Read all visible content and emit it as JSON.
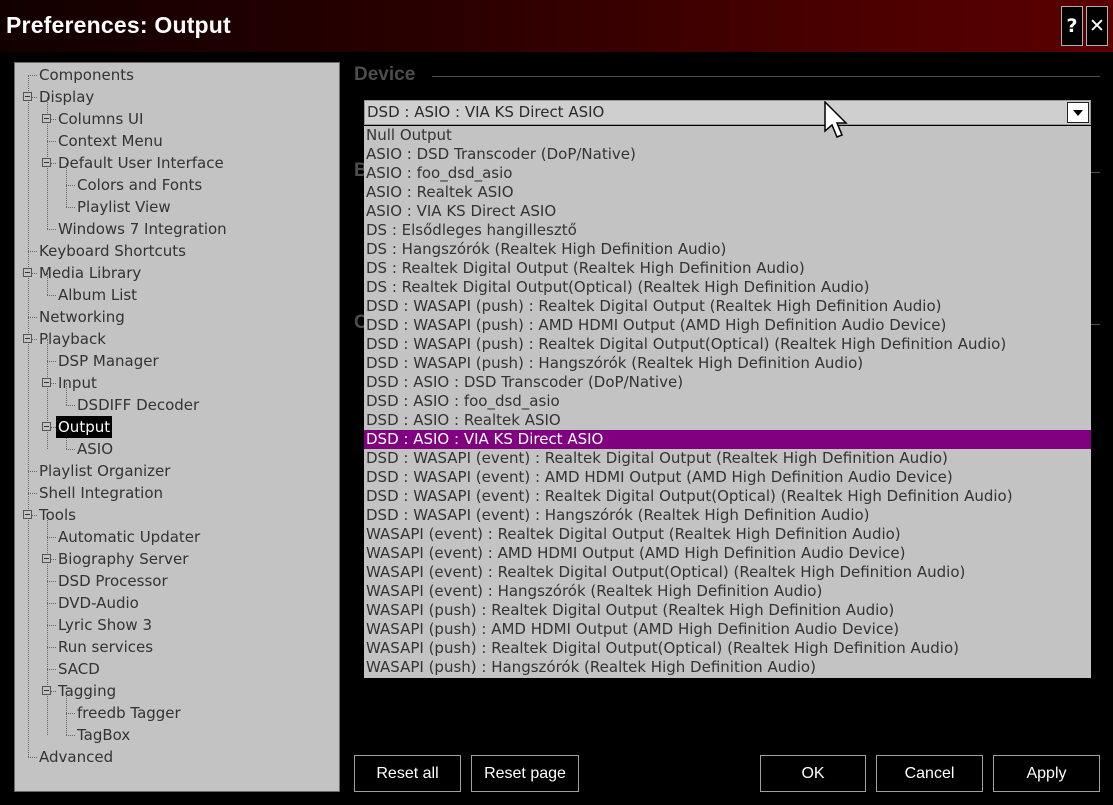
{
  "window": {
    "title": "Preferences: Output",
    "help_label": "?",
    "close_label": "✕"
  },
  "tree": {
    "items": [
      {
        "label": "Components"
      },
      {
        "label": "Display"
      },
      {
        "label": "Columns UI"
      },
      {
        "label": "Context Menu"
      },
      {
        "label": "Default User Interface"
      },
      {
        "label": "Colors and Fonts"
      },
      {
        "label": "Playlist View"
      },
      {
        "label": "Windows 7 Integration"
      },
      {
        "label": "Keyboard Shortcuts"
      },
      {
        "label": "Media Library"
      },
      {
        "label": "Album List"
      },
      {
        "label": "Networking"
      },
      {
        "label": "Playback"
      },
      {
        "label": "DSP Manager"
      },
      {
        "label": "Input"
      },
      {
        "label": "DSDIFF Decoder"
      },
      {
        "label": "Output"
      },
      {
        "label": "ASIO"
      },
      {
        "label": "Playlist Organizer"
      },
      {
        "label": "Shell Integration"
      },
      {
        "label": "Tools"
      },
      {
        "label": "Automatic Updater"
      },
      {
        "label": "Biography Server"
      },
      {
        "label": "DSD Processor"
      },
      {
        "label": "DVD-Audio"
      },
      {
        "label": "Lyric Show 3"
      },
      {
        "label": "Run services"
      },
      {
        "label": "SACD"
      },
      {
        "label": "Tagging"
      },
      {
        "label": "freedb Tagger"
      },
      {
        "label": "TagBox"
      },
      {
        "label": "Advanced"
      }
    ]
  },
  "device": {
    "section_title": "Device",
    "selected": "DSD : ASIO : VIA KS Direct ASIO",
    "options": [
      "Null Output",
      "ASIO : DSD Transcoder (DoP/Native)",
      "ASIO : foo_dsd_asio",
      "ASIO : Realtek ASIO",
      "ASIO : VIA KS Direct ASIO",
      "DS : Elsődleges hangillesztő",
      "DS : Hangszórók (Realtek High Definition Audio)",
      "DS : Realtek Digital Output (Realtek High Definition Audio)",
      "DS : Realtek Digital Output(Optical) (Realtek High Definition Audio)",
      "DSD : WASAPI (push) : Realtek Digital Output (Realtek High Definition Audio)",
      "DSD : WASAPI (push) : AMD HDMI Output (AMD High Definition Audio Device)",
      "DSD : WASAPI (push) : Realtek Digital Output(Optical) (Realtek High Definition Audio)",
      "DSD : WASAPI (push) : Hangszórók (Realtek High Definition Audio)",
      "DSD : ASIO : DSD Transcoder (DoP/Native)",
      "DSD : ASIO : foo_dsd_asio",
      "DSD : ASIO : Realtek ASIO",
      "DSD : ASIO : VIA KS Direct ASIO",
      "DSD : WASAPI (event) : Realtek Digital Output (Realtek High Definition Audio)",
      "DSD : WASAPI (event) : AMD HDMI Output (AMD High Definition Audio Device)",
      "DSD : WASAPI (event) : Realtek Digital Output(Optical) (Realtek High Definition Audio)",
      "DSD : WASAPI (event) : Hangszórók (Realtek High Definition Audio)",
      "WASAPI (event) : Realtek Digital Output (Realtek High Definition Audio)",
      "WASAPI (event) : AMD HDMI Output (AMD High Definition Audio Device)",
      "WASAPI (event) : Realtek Digital Output(Optical) (Realtek High Definition Audio)",
      "WASAPI (event) : Hangszórók (Realtek High Definition Audio)",
      "WASAPI (push) : Realtek Digital Output (Realtek High Definition Audio)",
      "WASAPI (push) : AMD HDMI Output (AMD High Definition Audio Device)",
      "WASAPI (push) : Realtek Digital Output(Optical) (Realtek High Definition Audio)",
      "WASAPI (push) : Hangszórók (Realtek High Definition Audio)"
    ],
    "highlighted_index": 16
  },
  "buttons": {
    "reset_all": "Reset all",
    "reset_page": "Reset page",
    "ok": "OK",
    "cancel": "Cancel",
    "apply": "Apply"
  },
  "colors": {
    "highlight": "#800080",
    "titlebar_end": "#5a0000"
  }
}
